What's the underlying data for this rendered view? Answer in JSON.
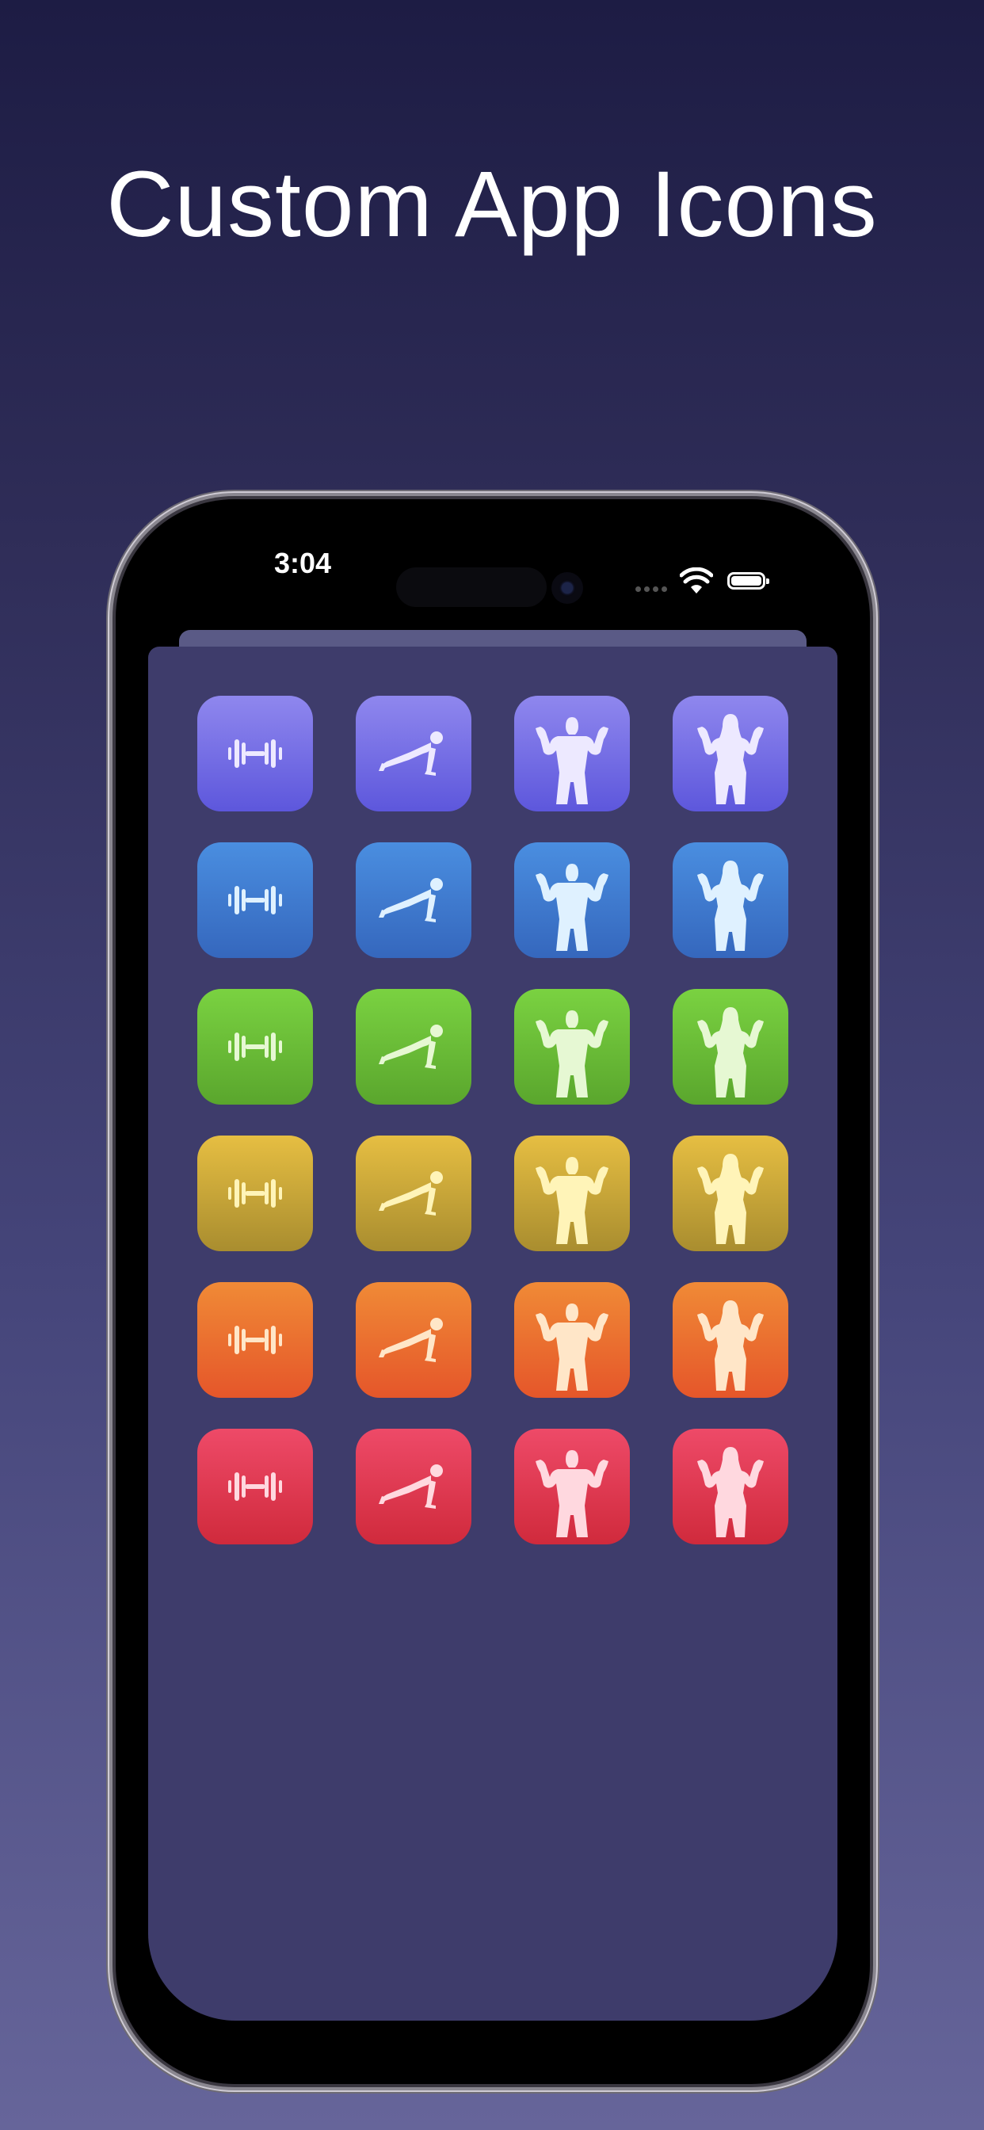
{
  "headline": "Custom App Icons",
  "status_bar": {
    "time": "3:04",
    "wifi_icon": "wifi-icon",
    "battery_icon": "battery-icon"
  },
  "icon_glyphs": [
    "dumbbell-icon",
    "pushup-icon",
    "male-bodybuilder-icon",
    "female-bodybuilder-icon"
  ],
  "icon_themes": [
    {
      "name": "purple",
      "top": "#8f87ee",
      "bottom": "#5d57dc",
      "glyph": "#ede9ff"
    },
    {
      "name": "blue",
      "top": "#4a8ee0",
      "bottom": "#3567bd",
      "glyph": "#dff1ff"
    },
    {
      "name": "green",
      "top": "#7ad241",
      "bottom": "#5aa62d",
      "glyph": "#e6f8d3"
    },
    {
      "name": "yellow",
      "top": "#e6be42",
      "bottom": "#a98d2f",
      "glyph": "#fff4b8"
    },
    {
      "name": "orange",
      "top": "#f08a36",
      "bottom": "#e5562a",
      "glyph": "#ffe6c8"
    },
    {
      "name": "red",
      "top": "#ee4a68",
      "bottom": "#d02a3c",
      "glyph": "#ffd8df"
    }
  ],
  "colors": {
    "sheet_background": "#3e3c6b",
    "page_gradient_top": "#1d1c44",
    "page_gradient_bottom": "#66659a"
  }
}
